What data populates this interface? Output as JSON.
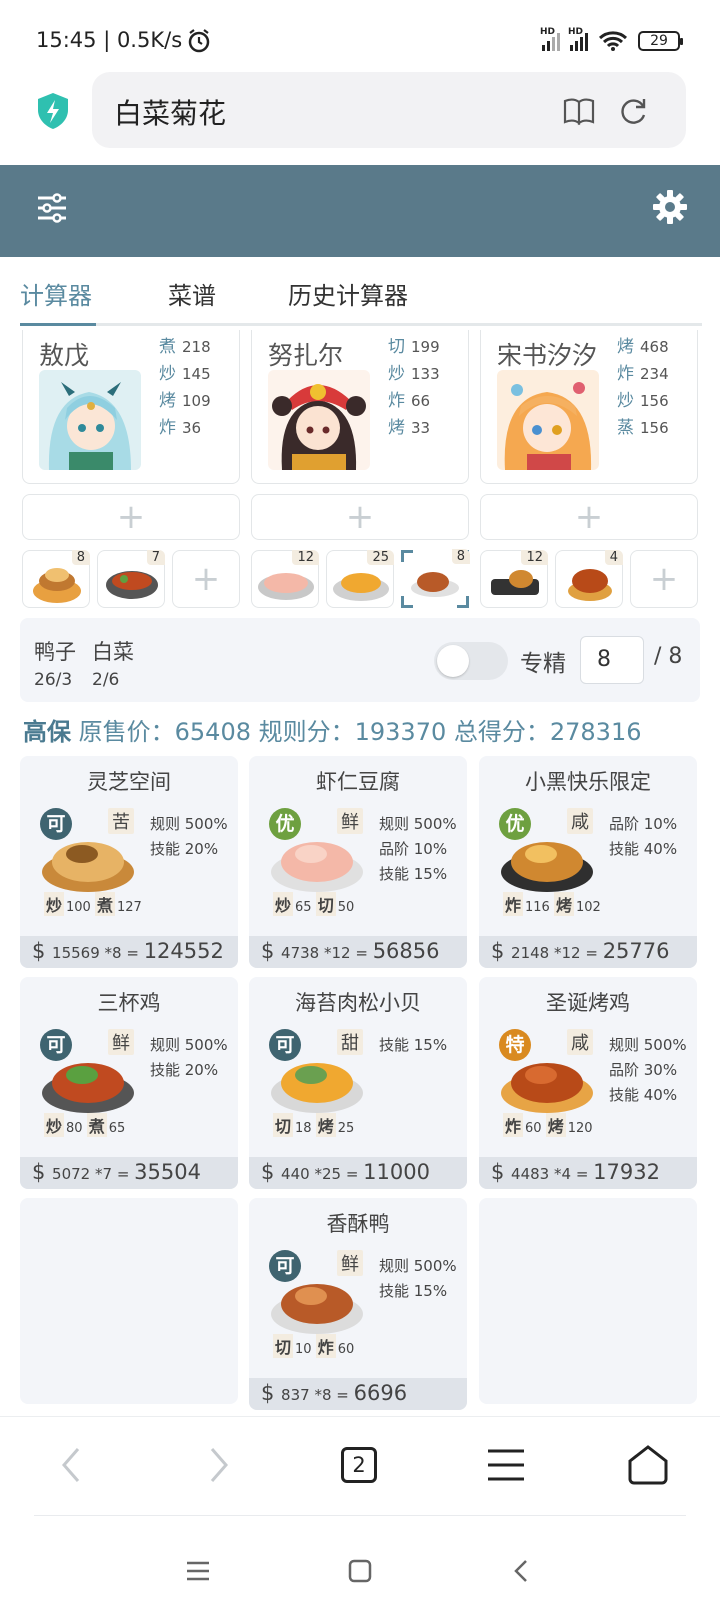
{
  "status_bar": {
    "time": "15:45 | 0.5K/s",
    "hd1": "HD",
    "hd2": "HD",
    "battery": "29"
  },
  "browser": {
    "title": "白菜菊花",
    "tab_count": "2"
  },
  "tabs": [
    "计算器",
    "菜谱",
    "历史计算器"
  ],
  "chefs": [
    {
      "name": "敖戊",
      "stats": [
        {
          "k": "煮",
          "v": "218"
        },
        {
          "k": "炒",
          "v": "145"
        },
        {
          "k": "烤",
          "v": "109"
        },
        {
          "k": "炸",
          "v": "36"
        }
      ]
    },
    {
      "name": "努扎尔",
      "stats": [
        {
          "k": "切",
          "v": "199"
        },
        {
          "k": "炒",
          "v": "133"
        },
        {
          "k": "炸",
          "v": "66"
        },
        {
          "k": "烤",
          "v": "33"
        }
      ]
    },
    {
      "name": "宋书汐汐",
      "stats": [
        {
          "k": "烤",
          "v": "468"
        },
        {
          "k": "炸",
          "v": "234"
        },
        {
          "k": "炒",
          "v": "156"
        },
        {
          "k": "蒸",
          "v": "156"
        }
      ]
    }
  ],
  "dish_slots": [
    {
      "count": "8"
    },
    {
      "count": "7"
    },
    {
      "count": ""
    },
    {
      "count": "12"
    },
    {
      "count": "25"
    },
    {
      "count": "8"
    },
    {
      "count": "12"
    },
    {
      "count": "4"
    },
    {
      "count": ""
    }
  ],
  "info": {
    "ingredient1": "鸭子",
    "ingredient1_ratio": "26/3",
    "ingredient2": "白菜",
    "ingredient2_ratio": "2/6",
    "specialize_label": "专精",
    "specialize_value": "8",
    "specialize_max": "/ 8"
  },
  "totals": {
    "label": "高保",
    "text": "原售价：65408 规则分：193370 总得分：278316"
  },
  "recipes": [
    {
      "name": "灵芝空间",
      "grade": "可",
      "taste": "苦",
      "bonus": [
        "规则 500%",
        "技能 20%"
      ],
      "skills": [
        {
          "k": "炒",
          "v": "100"
        },
        {
          "k": "煮",
          "v": "127"
        }
      ],
      "price_unit": "15569 *8",
      "price_total": "124552"
    },
    {
      "name": "虾仁豆腐",
      "grade": "优",
      "taste": "鲜",
      "bonus": [
        "规则 500%",
        "品阶 10%",
        "技能 15%"
      ],
      "skills": [
        {
          "k": "炒",
          "v": "65"
        },
        {
          "k": "切",
          "v": "50"
        }
      ],
      "price_unit": "4738 *12",
      "price_total": "56856"
    },
    {
      "name": "小黑快乐限定",
      "grade": "优",
      "taste": "咸",
      "bonus": [
        "品阶 10%",
        "技能 40%"
      ],
      "skills": [
        {
          "k": "炸",
          "v": "116"
        },
        {
          "k": "烤",
          "v": "102"
        }
      ],
      "price_unit": "2148 *12",
      "price_total": "25776"
    },
    {
      "name": "三杯鸡",
      "grade": "可",
      "taste": "鲜",
      "bonus": [
        "规则 500%",
        "技能 20%"
      ],
      "skills": [
        {
          "k": "炒",
          "v": "80"
        },
        {
          "k": "煮",
          "v": "65"
        }
      ],
      "price_unit": "5072 *7",
      "price_total": "35504"
    },
    {
      "name": "海苔肉松小贝",
      "grade": "可",
      "taste": "甜",
      "bonus": [
        "技能 15%"
      ],
      "skills": [
        {
          "k": "切",
          "v": "18"
        },
        {
          "k": "烤",
          "v": "25"
        }
      ],
      "price_unit": "440 *25",
      "price_total": "11000"
    },
    {
      "name": "圣诞烤鸡",
      "grade": "特",
      "taste": "咸",
      "bonus": [
        "规则 500%",
        "品阶 30%",
        "技能 40%"
      ],
      "skills": [
        {
          "k": "炸",
          "v": "60"
        },
        {
          "k": "烤",
          "v": "120"
        }
      ],
      "price_unit": "4483 *4",
      "price_total": "17932"
    },
    {
      "name": "香酥鸭",
      "grade": "可",
      "taste": "鲜",
      "bonus": [
        "规则 500%",
        "技能 15%"
      ],
      "skills": [
        {
          "k": "切",
          "v": "10"
        },
        {
          "k": "炸",
          "v": "60"
        }
      ],
      "price_unit": "837 *8",
      "price_total": "6696"
    }
  ],
  "colors": {
    "header": "#5a7a8a",
    "accent": "#5a8aa0",
    "grade_ke": "#3f6470",
    "grade_you": "#6ea040",
    "grade_te": "#d98a20"
  }
}
